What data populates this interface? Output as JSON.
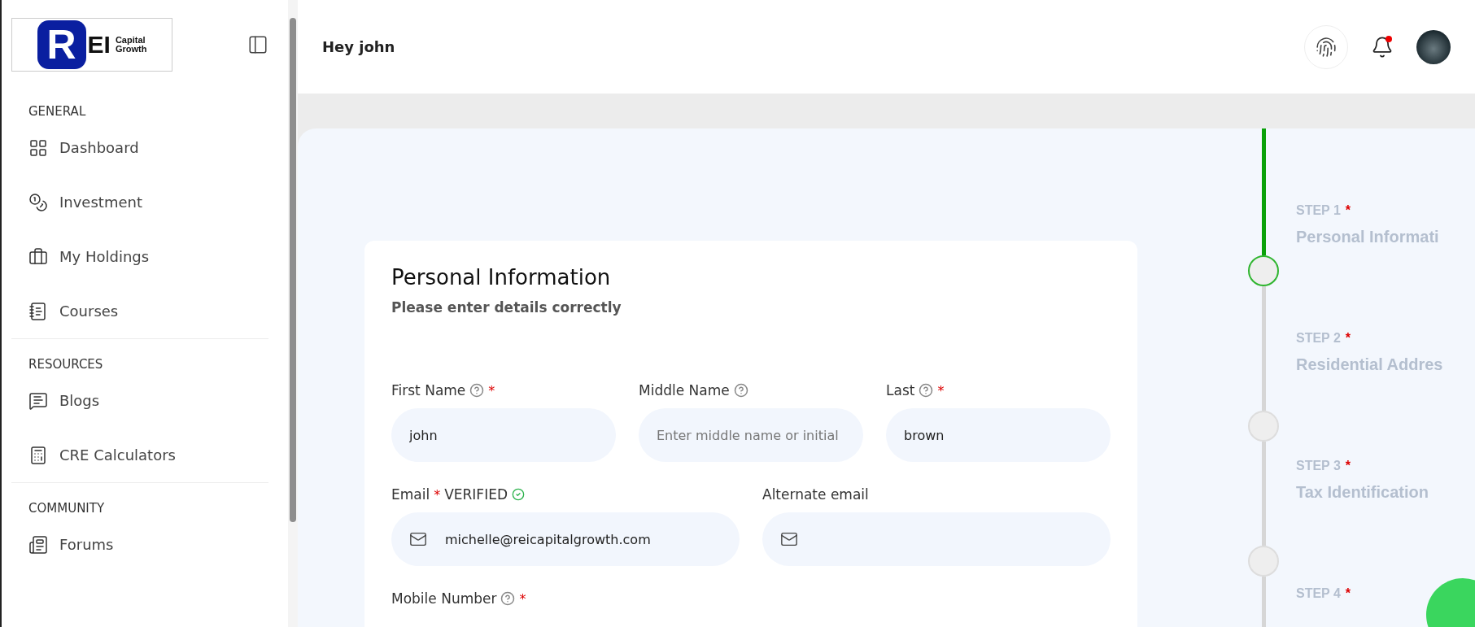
{
  "logo": {
    "mark": "R",
    "letters": "EI",
    "line1": "Capital",
    "line2": "Growth"
  },
  "sidebar": {
    "sections": [
      {
        "title": "GENERAL",
        "items": [
          {
            "label": "Dashboard"
          },
          {
            "label": "Investment"
          },
          {
            "label": "My Holdings"
          },
          {
            "label": "Courses"
          }
        ]
      },
      {
        "title": "RESOURCES",
        "items": [
          {
            "label": "Blogs"
          },
          {
            "label": "CRE Calculators"
          }
        ]
      },
      {
        "title": "COMMUNITY",
        "items": [
          {
            "label": "Forums"
          }
        ]
      }
    ]
  },
  "header": {
    "greeting": "Hey john",
    "notifications_unread": true
  },
  "form": {
    "title": "Personal Information",
    "subtitle": "Please enter details correctly",
    "rows": [
      [
        {
          "kind": "text",
          "label": "First Name",
          "help": true,
          "required": "*",
          "value": "john"
        },
        {
          "kind": "text",
          "label": "Middle Name",
          "help": true,
          "placeholder": "Enter middle name or initial"
        },
        {
          "kind": "text",
          "label": "Last",
          "help": true,
          "required": "*",
          "value": "brown"
        }
      ],
      [
        {
          "kind": "email",
          "label": "Email",
          "help": false,
          "required": "*",
          "verified": "VERIFIED",
          "value": "michelle@reicapitalgrowth.com"
        },
        {
          "kind": "email",
          "label": "Alternate email",
          "help": false
        }
      ],
      [
        {
          "kind": "label",
          "label": "Mobile Number",
          "help": true,
          "required": "*"
        }
      ]
    ]
  },
  "stepper": {
    "steps": [
      {
        "step": "STEP 1",
        "required": "*",
        "title": "Personal Informati",
        "current": true
      },
      {
        "step": "STEP 2",
        "required": "*",
        "title": "Residential Addres",
        "current": false
      },
      {
        "step": "STEP 3",
        "required": "*",
        "title": "Tax Identification",
        "current": false
      },
      {
        "step": "STEP 4",
        "required": "*"
      }
    ]
  }
}
